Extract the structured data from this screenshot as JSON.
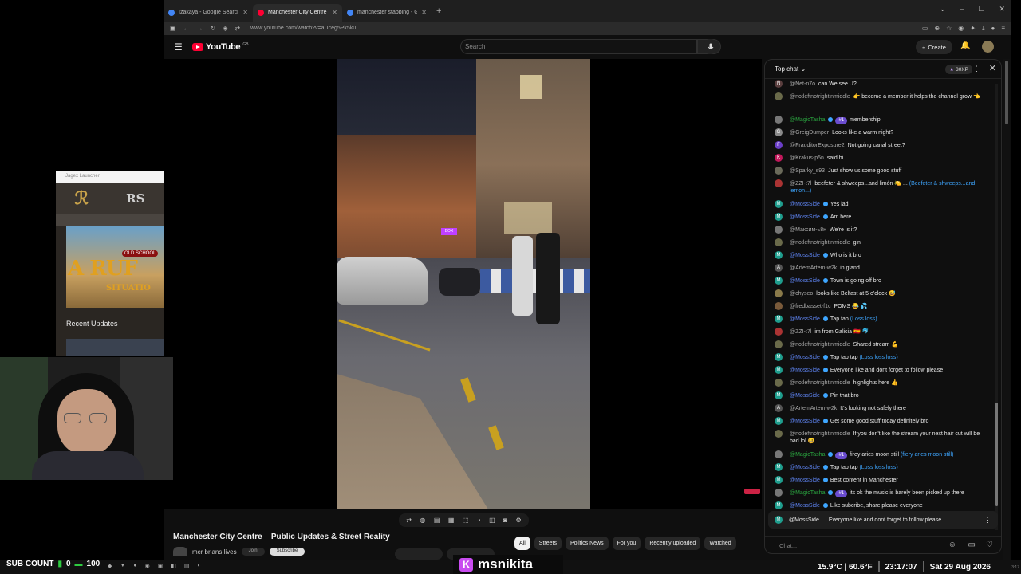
{
  "browser": {
    "tabs": [
      {
        "label": "Izakaya - Google Search",
        "color": "#4285f4"
      },
      {
        "label": "Manchester City Centre – P",
        "color": "#ff0033"
      },
      {
        "label": "manchester stabbing - Google",
        "color": "#4285f4"
      }
    ],
    "url": "www.youtube.com/watch?v=aUceg5Pk5k0"
  },
  "youtube": {
    "brand": "YouTube",
    "country_code": "GB",
    "search_placeholder": "Search",
    "create_label": "Create"
  },
  "video": {
    "sign_text": "BOX",
    "title": "Manchester City Centre – Public Updates & Street Reality",
    "channel": "mcr brians lives",
    "pill_join": "Join",
    "pill_subscribe": "Subscribe",
    "filters": [
      "All",
      "Streets",
      "Politics News",
      "For you",
      "Recently uploaded",
      "Watched"
    ]
  },
  "chat": {
    "header": "Top chat",
    "xp": "30XP",
    "input_placeholder": "Chat...",
    "messages": [
      {
        "author": "@Net-n7o",
        "text": "can We see U?",
        "avatar": "N",
        "color": "#5a3e3e"
      },
      {
        "author": "@notleftnotrightinmiddle",
        "text": "👉 become a member it helps the channel grow 👈",
        "avatar": "",
        "color": "#6a6a4a"
      },
      {
        "author": "@MagicTasha",
        "rank": "#1",
        "text": "membership",
        "avatar": "",
        "color": "#777",
        "mem": true
      },
      {
        "author": "@GreigDumper",
        "text": "Looks like a warm night?",
        "avatar": "G",
        "color": "#8a8a8a"
      },
      {
        "author": "@FrauditorExposure2",
        "text": "Not going canal street?",
        "avatar": "F",
        "color": "#6a3ec7"
      },
      {
        "author": "@Krakus-p5n",
        "text": "said hi",
        "avatar": "K",
        "color": "#c2185b"
      },
      {
        "author": "@Sparky_s93",
        "text": "Just show us some good stuff",
        "avatar": "",
        "color": "#6a6a5a"
      },
      {
        "author": "@ZZI-t7l",
        "text": "beefeter & shweeps...and limón 🍋 ...",
        "translation": "(Beefeter & shweeps...and lemon...)",
        "avatar": "",
        "color": "#aa3333"
      },
      {
        "author": "@MossSide",
        "text": "Yes lad",
        "avatar": "M",
        "color": "#1f9e8e",
        "mod": true
      },
      {
        "author": "@MossSide",
        "text": "Am here",
        "avatar": "M",
        "color": "#1f9e8e",
        "mod": true
      },
      {
        "author": "@Максим-ь8н",
        "text": "We're is it?",
        "avatar": "",
        "color": "#777"
      },
      {
        "author": "@notleftnotrightinmiddle",
        "text": "gin",
        "avatar": "",
        "color": "#6a6a4a"
      },
      {
        "author": "@MossSide",
        "text": "Who is it bro",
        "avatar": "M",
        "color": "#1f9e8e",
        "mod": true
      },
      {
        "author": "@ArtemArtem-w2k",
        "text": "in gland",
        "avatar": "A",
        "color": "#555"
      },
      {
        "author": "@MossSide",
        "text": "Town is going off bro",
        "avatar": "M",
        "color": "#1f9e8e",
        "mod": true
      },
      {
        "author": "@chyseo",
        "text": "looks like Belfast at 5 o'clock 😅",
        "avatar": "",
        "color": "#8a7a4a"
      },
      {
        "author": "@fredbasset-f1c",
        "text": "POMS 😂 💦",
        "avatar": "",
        "color": "#7a5a3a"
      },
      {
        "author": "@MossSide",
        "text": "Tap tap",
        "translation": "(Loss loss)",
        "avatar": "M",
        "color": "#1f9e8e",
        "mod": true
      },
      {
        "author": "@ZZI-t7l",
        "text": "im from Galicia 🇪🇸 🐬",
        "avatar": "",
        "color": "#aa3333"
      },
      {
        "author": "@notleftnotrightinmiddle",
        "text": "Shared stream 💪",
        "avatar": "",
        "color": "#6a6a4a"
      },
      {
        "author": "@MossSide",
        "text": "Tap tap tap",
        "translation": "(Loss loss loss)",
        "avatar": "M",
        "color": "#1f9e8e",
        "mod": true
      },
      {
        "author": "@MossSide",
        "text": "Everyone like and dont forget to follow please",
        "avatar": "M",
        "color": "#1f9e8e",
        "mod": true
      },
      {
        "author": "@notleftnotrightinmiddle",
        "text": "highlights here 👍",
        "avatar": "",
        "color": "#6a6a4a"
      },
      {
        "author": "@MossSide",
        "text": "Pin that bro",
        "avatar": "M",
        "color": "#1f9e8e",
        "mod": true
      },
      {
        "author": "@ArtemArtem-w2k",
        "text": "It's looking not safely there",
        "avatar": "A",
        "color": "#555"
      },
      {
        "author": "@MossSide",
        "text": "Get some good stuff today definitely bro",
        "avatar": "M",
        "color": "#1f9e8e",
        "mod": true
      },
      {
        "author": "@notleftnotrightinmiddle",
        "text": "If you don't like the stream your next hair cut will be bad lol 😆",
        "avatar": "",
        "color": "#6a6a4a"
      },
      {
        "author": "@MagicTasha",
        "rank": "#1",
        "text": "firey aries moon still",
        "translation": "(fiery aries moon still)",
        "avatar": "",
        "color": "#777",
        "mem": true
      },
      {
        "author": "@MossSide",
        "text": "Tap tap tap",
        "translation": "(Loss loss loss)",
        "avatar": "M",
        "color": "#1f9e8e",
        "mod": true
      },
      {
        "author": "@MossSide",
        "text": "Best content in Manchester",
        "avatar": "M",
        "color": "#1f9e8e",
        "mod": true
      },
      {
        "author": "@MagicTasha",
        "rank": "#1",
        "text": "its ok the music is barely been picked up there",
        "avatar": "",
        "color": "#777",
        "mem": true
      },
      {
        "author": "@MossSide",
        "text": "Like subcribe, share please everyone",
        "avatar": "M",
        "color": "#1f9e8e",
        "mod": true
      }
    ],
    "pinned": {
      "author": "@MossSide",
      "text": "Everyone like and dont forget to follow please",
      "avatar": "M"
    }
  },
  "overlay": {
    "launcher_title": "Jagex Launcher",
    "rs_label": "RS",
    "banner_text": "A RUF",
    "banner_sub": "SITUATIO",
    "old_school": "OLD SCHOOL",
    "recent_updates": "Recent Updates"
  },
  "status": {
    "sub_label": "SUB COUNT",
    "sub_value": "0",
    "sub_goal": "100",
    "streamer": "msnikita",
    "temperature": "15.9°C | 60.6°F",
    "time": "23:17:07",
    "date": "Sat 29 Aug 2026",
    "tiny_time": "3:17"
  }
}
